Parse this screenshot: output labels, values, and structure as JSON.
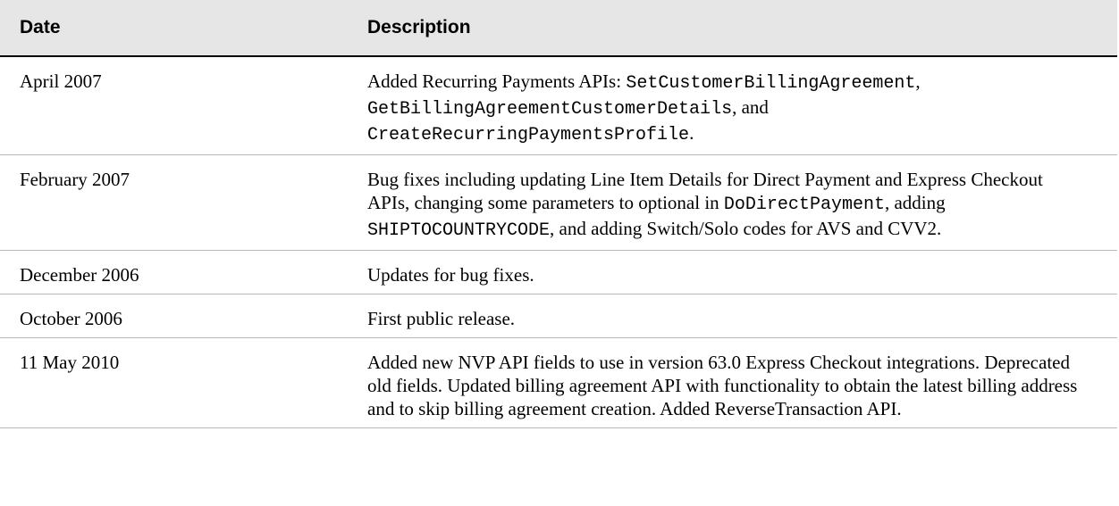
{
  "table": {
    "headers": {
      "date": "Date",
      "description": "Description"
    },
    "rows": [
      {
        "date": "April 2007",
        "description": [
          {
            "text": "Added Recurring Payments APIs: ",
            "code": false
          },
          {
            "text": "SetCustomerBillingAgreement",
            "code": true
          },
          {
            "text": ", ",
            "code": false
          },
          {
            "text": "GetBillingAgreementCustomerDetails",
            "code": true
          },
          {
            "text": ", and ",
            "code": false
          },
          {
            "text": "CreateRecurringPaymentsProfile",
            "code": true
          },
          {
            "text": ".",
            "code": false
          }
        ]
      },
      {
        "date": "February 2007",
        "description": [
          {
            "text": "Bug fixes including updating Line Item Details for Direct Payment and Express Checkout APIs, changing some parameters to optional in ",
            "code": false
          },
          {
            "text": "DoDirectPayment",
            "code": true
          },
          {
            "text": ", adding ",
            "code": false
          },
          {
            "text": "SHIPTOCOUNTRYCODE",
            "code": true
          },
          {
            "text": ", and adding Switch/Solo codes for AVS and CVV2.",
            "code": false
          }
        ]
      },
      {
        "date": "December 2006",
        "description": [
          {
            "text": "Updates for bug fixes.",
            "code": false
          }
        ]
      },
      {
        "date": "October 2006",
        "description": [
          {
            "text": "First public release.",
            "code": false
          }
        ]
      },
      {
        "date": "11 May 2010",
        "description": [
          {
            "text": "Added new NVP API fields to use in version 63.0 Express Checkout integrations. Deprecated old fields. Updated billing agreement API with functionality to obtain the latest billing address and to skip billing agreement creation. Added ReverseTransaction API.",
            "code": false
          }
        ]
      }
    ]
  }
}
